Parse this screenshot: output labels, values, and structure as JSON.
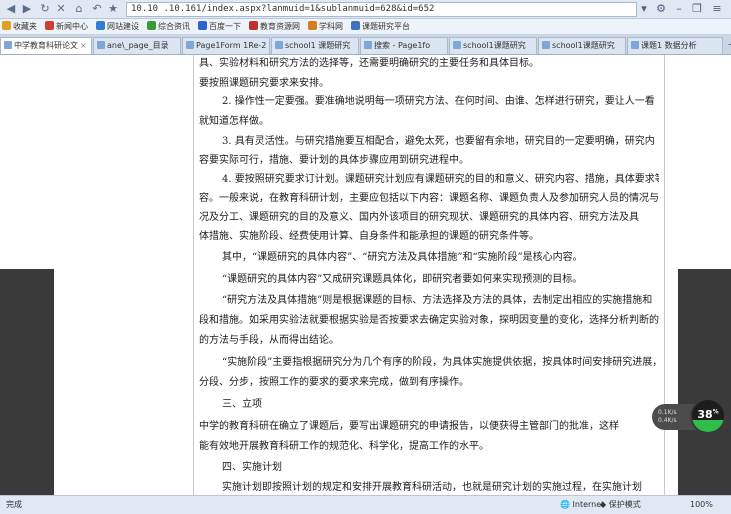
{
  "browser": {
    "url": "10.10 .10.161/index.aspx?lanmuid=1&sublanmuid=628&id=652",
    "tabs": [
      {
        "label": "中学教育科研论文",
        "active": true
      },
      {
        "label": "ane\\_page_目录",
        "active": false
      },
      {
        "label": "Page1Form 1Re-2",
        "active": false
      },
      {
        "label": "school1 课题研究",
        "active": false
      },
      {
        "label": "搜索 - Page1fo",
        "active": false
      },
      {
        "label": "school1课题研究",
        "active": false
      },
      {
        "label": "school1课题研究",
        "active": false
      },
      {
        "label": "课题1 数据分析",
        "active": false
      }
    ],
    "bookmarks": [
      {
        "label": "收藏夹",
        "color": "#e0a020"
      },
      {
        "label": "新闻中心",
        "color": "#d04030"
      },
      {
        "label": "网站建设",
        "color": "#2f7fd0"
      },
      {
        "label": "综合资讯",
        "color": "#3a9a3a"
      },
      {
        "label": "百度一下",
        "color": "#2f60d0"
      },
      {
        "label": "教育资源网",
        "color": "#c03030"
      },
      {
        "label": "学科网",
        "color": "#d08020"
      },
      {
        "label": "课题研究平台",
        "color": "#4070c0"
      }
    ]
  },
  "document": {
    "lines": [
      {
        "text": "具、实验材料和研究方法的选择等，还需要明确研究的主要任务和具体目标。",
        "indent": false
      },
      {
        "text": "要按照课题研究要求来安排。",
        "indent": false
      },
      {
        "text": "2. 操作性一定要强。要准确地说明每一项研究方法、在何时间、由谁、怎样进行研究，要让人一看",
        "indent": true
      },
      {
        "text": "就知道怎样做。",
        "indent": false
      },
      {
        "text": "3. 具有灵活性。与研究措施要互相配合，避免太死，也要留有余地，研究目的一定要明确，研究内",
        "indent": true
      },
      {
        "text": "容要实际可行，措施、要计划的具体步骤应用到研究进程中。",
        "indent": false
      },
      {
        "text": "4. 要按照研究要求订计划。课题研究计划应有课题研究的目的和意义、研究内容、措施，具体要求等内",
        "indent": true
      },
      {
        "text": "容。一般来说，在教育科研计划，主要应包括以下内容：课题名称、课题负责人及参加研究人员的情况与",
        "indent": false
      },
      {
        "text": "况及分工、课题研究的目的及意义、国内外该项目的研究现状、课题研究的具体内容、研究方法及具",
        "indent": false
      },
      {
        "text": "体措施、实施阶段、经费使用计算、自身条件和能承担的课题的研究条件等。",
        "indent": false
      },
      {
        "text": "其中，“课题研究的具体内容”、“研究方法及具体措施”和“实施阶段”是核心内容。",
        "indent": true
      },
      {
        "text": "“课题研究的具体内容”又成研究课题具体化，即研究者要如何来实现预测的目标。",
        "indent": true
      },
      {
        "text": "“研究方法及具体措施”则是根据课题的目标、方法选择及方法的具体，去制定出相应的实施措施和",
        "indent": true
      },
      {
        "text": "段和措施。如采用实验法就要根据实验是否按要求去确定实验对象，探明因变量的变化，选择分析判断的",
        "indent": false
      },
      {
        "text": "的方法与手段，从而得出结论。",
        "indent": false
      },
      {
        "text": "“实施阶段”主要指根据研究分为几个有序的阶段，为具体实施提供依据，按具体时间安排研究进展，",
        "indent": true
      },
      {
        "text": "分段、分步，按照工作的要求的要求来完成，做到有序操作。",
        "indent": false
      },
      {
        "text": "三、立项",
        "indent": true
      },
      {
        "text": "中学的教育科研在确立了课题后，要写出课题研究的申请报告，以便获得主管部门的批准，这样",
        "indent": false
      },
      {
        "text": "能有效地开展教育科研工作的规范化、科学化，提高工作的水平。",
        "indent": false
      },
      {
        "text": "四、实施计划",
        "indent": true
      },
      {
        "text": "实施计划即按照计划的规定和安排开展教育科研活动，也就是研究计划的实施过程，在实施计划",
        "indent": true
      }
    ]
  },
  "speed_widget": {
    "percent_label": "38",
    "percent_sign": "%",
    "up": "0.1K/s",
    "down": "0.4K/s",
    "percent": 38
  },
  "status": {
    "left": "完成",
    "zone": "Internet",
    "protect": "保护模式",
    "zoom": "100%"
  }
}
